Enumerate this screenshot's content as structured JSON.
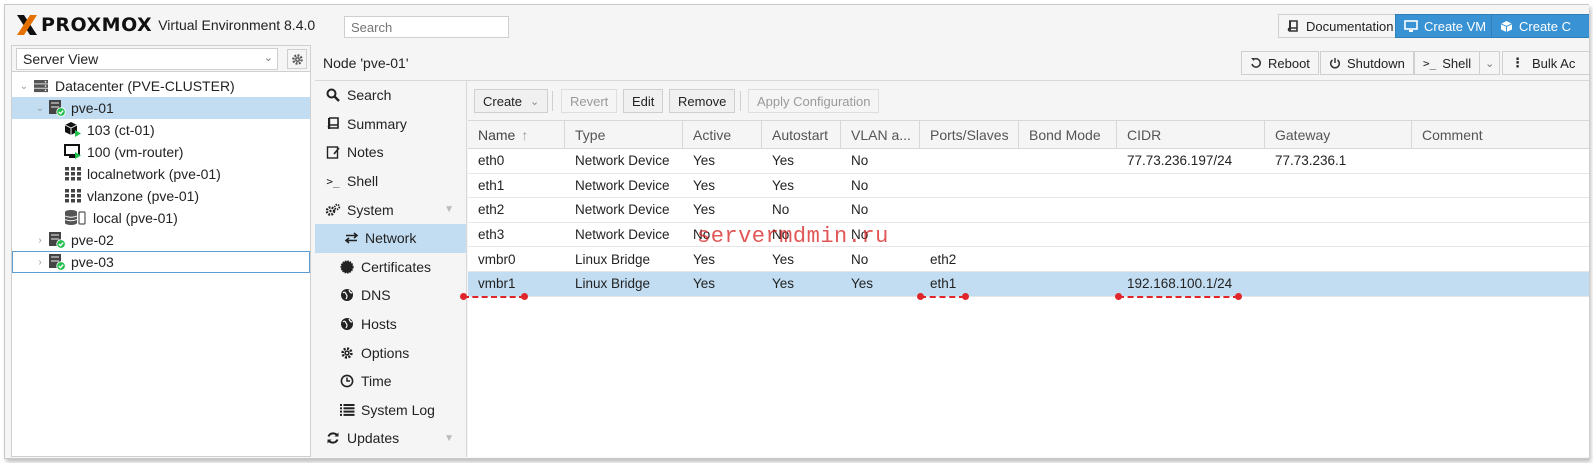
{
  "app": {
    "logo_text": "PROXMOX",
    "product": "Virtual Environment 8.4.0",
    "search_placeholder": "Search"
  },
  "topbar": {
    "documentation": "Documentation",
    "create_vm": "Create VM",
    "create_ct": "Create C"
  },
  "left": {
    "view": "Server View",
    "tree": [
      {
        "label": "Datacenter (PVE-CLUSTER)",
        "icon": "datacenter-icon"
      },
      {
        "label": "pve-01",
        "icon": "node-online-icon"
      },
      {
        "label": "103 (ct-01)",
        "icon": "container-running-icon"
      },
      {
        "label": "100 (vm-router)",
        "icon": "vm-running-icon"
      },
      {
        "label": "localnetwork (pve-01)",
        "icon": "sdn-zone-icon"
      },
      {
        "label": "vlanzone (pve-01)",
        "icon": "sdn-zone-icon"
      },
      {
        "label": "local (pve-01)",
        "icon": "storage-icon"
      },
      {
        "label": "pve-02",
        "icon": "node-online-icon"
      },
      {
        "label": "pve-03",
        "icon": "node-online-icon"
      }
    ]
  },
  "node": {
    "title": "Node 'pve-01'",
    "reboot": "Reboot",
    "shutdown": "Shutdown",
    "shell": "Shell",
    "bulk": "Bulk Ac"
  },
  "menu": [
    {
      "label": "Search",
      "icon": "search-icon"
    },
    {
      "label": "Summary",
      "icon": "summary-icon"
    },
    {
      "label": "Notes",
      "icon": "notes-icon"
    },
    {
      "label": "Shell",
      "icon": "terminal-icon"
    },
    {
      "label": "System",
      "icon": "cogs-icon"
    },
    {
      "label": "Network",
      "icon": "exchange-icon"
    },
    {
      "label": "Certificates",
      "icon": "certificate-icon"
    },
    {
      "label": "DNS",
      "icon": "globe-icon"
    },
    {
      "label": "Hosts",
      "icon": "globe-icon"
    },
    {
      "label": "Options",
      "icon": "gear-icon"
    },
    {
      "label": "Time",
      "icon": "clock-icon"
    },
    {
      "label": "System Log",
      "icon": "list-icon"
    },
    {
      "label": "Updates",
      "icon": "refresh-icon"
    }
  ],
  "toolbar": {
    "create": "Create",
    "revert": "Revert",
    "edit": "Edit",
    "remove": "Remove",
    "apply": "Apply Configuration"
  },
  "grid": {
    "columns": [
      "Name",
      "Type",
      "Active",
      "Autostart",
      "VLAN a...",
      "Ports/Slaves",
      "Bond Mode",
      "CIDR",
      "Gateway",
      "Comment"
    ],
    "sort_column": "Name",
    "sort_direction": "ascending",
    "rows": [
      [
        "eth0",
        "Network Device",
        "Yes",
        "Yes",
        "No",
        "",
        "",
        "77.73.236.197/24",
        "77.73.236.1",
        ""
      ],
      [
        "eth1",
        "Network Device",
        "Yes",
        "Yes",
        "No",
        "",
        "",
        "",
        "",
        ""
      ],
      [
        "eth2",
        "Network Device",
        "Yes",
        "No",
        "No",
        "",
        "",
        "",
        "",
        ""
      ],
      [
        "eth3",
        "Network Device",
        "No",
        "No",
        "No",
        "",
        "",
        "",
        "",
        ""
      ],
      [
        "vmbr0",
        "Linux Bridge",
        "Yes",
        "Yes",
        "No",
        "eth2",
        "",
        "",
        "",
        ""
      ],
      [
        "vmbr1",
        "Linux Bridge",
        "Yes",
        "Yes",
        "Yes",
        "eth1",
        "",
        "192.168.100.1/24",
        "",
        ""
      ]
    ],
    "selected_row": 5
  },
  "watermark": "servermdmin.ru",
  "colors": {
    "selection": "#c2ddf2",
    "primary_button": "#3892d4",
    "annotation": "#e0262b",
    "logo_orange": "#e57000"
  }
}
